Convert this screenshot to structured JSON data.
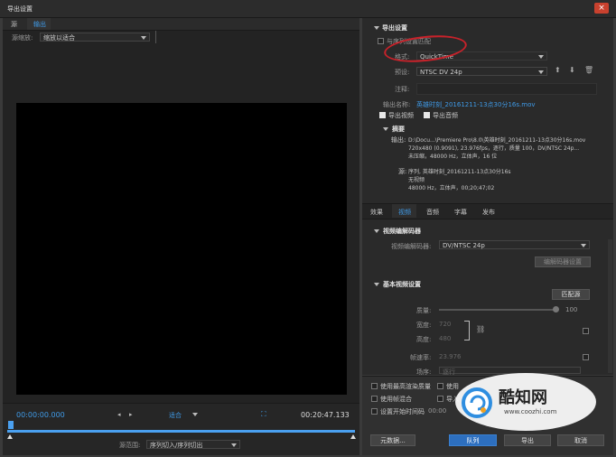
{
  "window": {
    "title": "导出设置",
    "close": "×"
  },
  "tabs": [
    "源",
    "输出"
  ],
  "source_scaling": {
    "label": "源缩放:",
    "value": "缩放以适合"
  },
  "export_settings": {
    "header": "导出设置",
    "match_sequence": "与序列设置匹配",
    "format_label": "格式:",
    "format_value": "QuickTime",
    "preset_label": "预设:",
    "preset_value": "NTSC DV 24p",
    "comments_label": "注释:",
    "output_name_label": "输出名称:",
    "output_name_value": "英雄时刻_20161211-13点30分16s.mov",
    "export_video": "导出视频",
    "export_audio": "导出音频",
    "summary_header": "摘要",
    "output_label": "输出:",
    "output_lines": [
      "D:\\Docu...\\Premiere Pro\\8.0\\英雄时刻_20161211-13点30分16s.mov",
      "720x480 (0.9091), 23.976fps，逐行，质量 100，DV/NTSC 24p...",
      "未压缩，48000 Hz，立体声，16 位"
    ],
    "source_label": "源:",
    "source_lines": [
      "序列, 英雄时刻_20161211-13点30分16s",
      "无视频",
      "48000 Hz，立体声，00;20;47;02"
    ]
  },
  "settings_tabs": [
    "效果",
    "视频",
    "音频",
    "字幕",
    "发布"
  ],
  "video_codec": {
    "header": "视频编解码器",
    "codec_label": "视频编解码器:",
    "codec_value": "DV/NTSC 24p",
    "codec_settings_button": "编解码器设置"
  },
  "basic_video": {
    "header": "基本视频设置",
    "match_source_button": "匹配源",
    "quality_label": "质量:",
    "quality_value": "100",
    "width_label": "宽度:",
    "width_value": "720",
    "height_label": "高度:",
    "height_value": "480",
    "frame_rate_label": "帧速率:",
    "frame_rate_value": "23.976",
    "field_order_label": "场序:",
    "field_order_value": "逐行"
  },
  "bottom_options": {
    "max_render": "使用最高渲染质量",
    "use_previews": "使用",
    "frame_blending": "使用帧混合",
    "import": "导入",
    "set_start_tc": "设置开始时间码",
    "start_tc_value": "00:00"
  },
  "buttons": {
    "metadata": "元数据...",
    "queue": "队列",
    "export": "导出",
    "cancel": "取消"
  },
  "timeline": {
    "in_time": "00:00:00.000",
    "out_time": "00:20:47.133",
    "fit": "适合",
    "source_range_label": "源范围:",
    "source_range_value": "序列切入/序列切出"
  },
  "watermark": {
    "brand": "酷知网",
    "url": "www.coozhi.com"
  }
}
